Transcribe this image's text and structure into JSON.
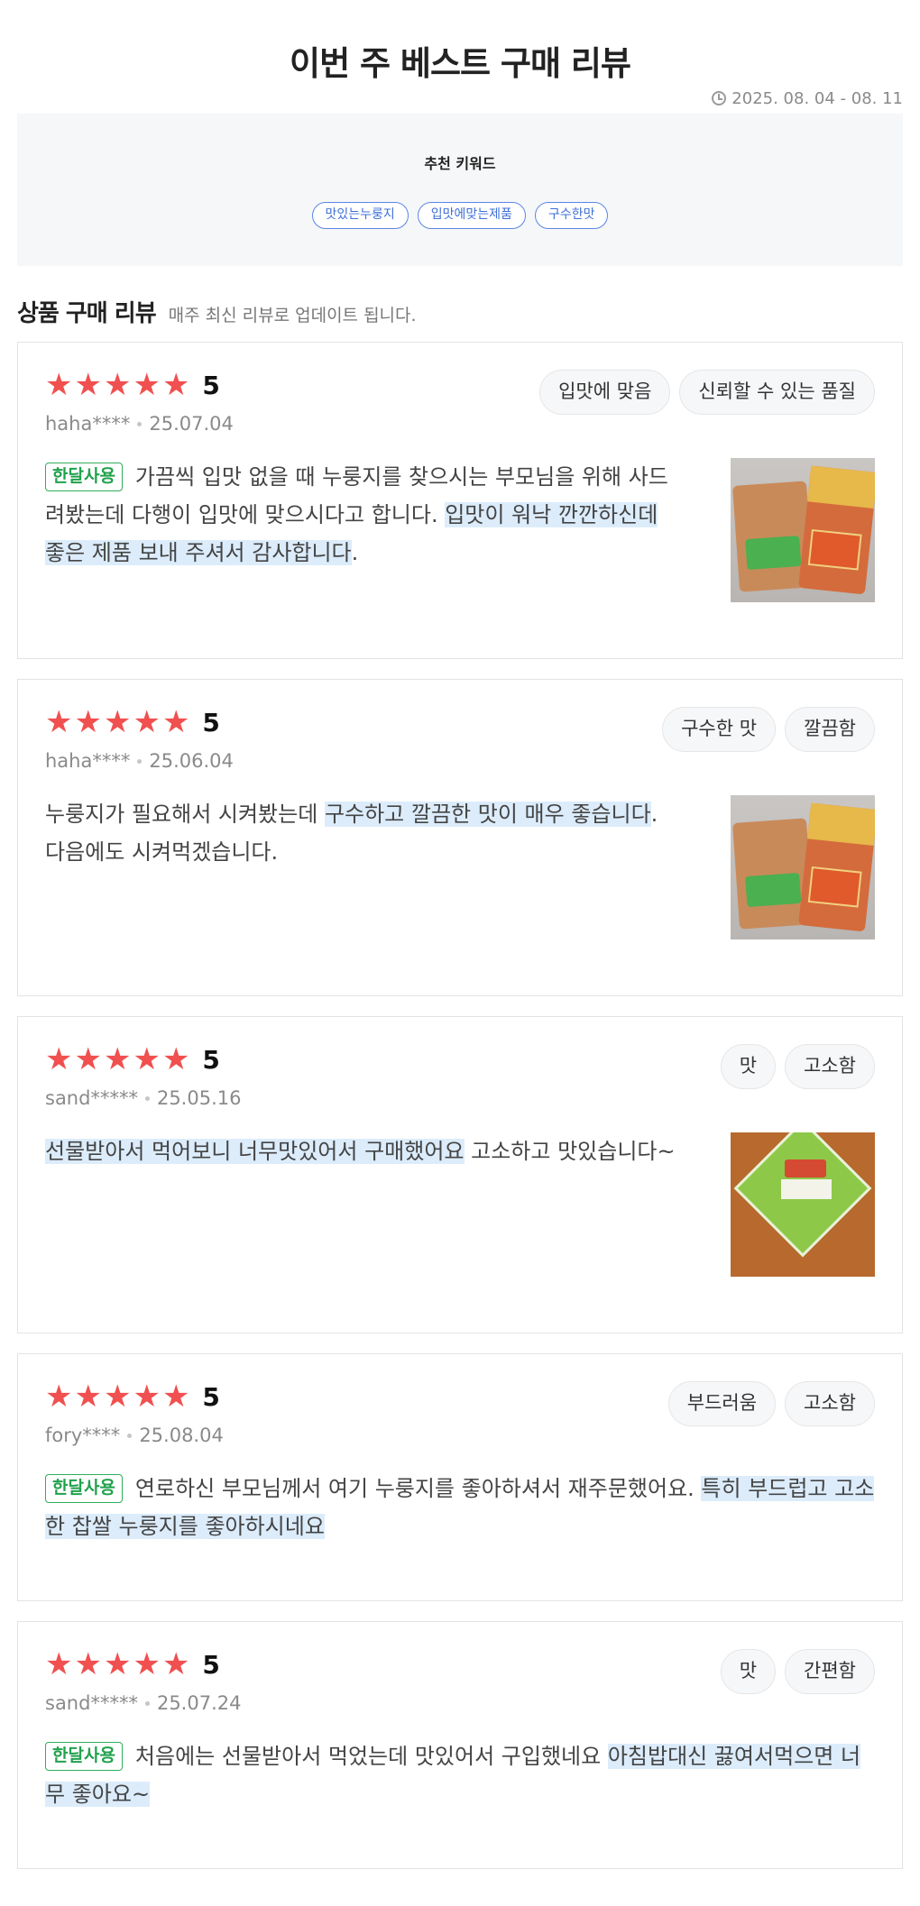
{
  "header": {
    "title": "이번 주 베스트 구매 리뷰",
    "period": "2025. 08. 04 - 08. 11"
  },
  "keywords": {
    "title": "추천 키워드",
    "chips": [
      "맛있는누룽지",
      "입맛에맞는제품",
      "구수한맛"
    ]
  },
  "section": {
    "title": "상품 구매 리뷰",
    "subtitle": "매주 최신 리뷰로 업데이트 됩니다."
  },
  "reviews": [
    {
      "rating": "5",
      "user": "haha****",
      "date": "25.07.04",
      "tags": [
        "입맛에 맞음",
        "신뢰할 수 있는 품질"
      ],
      "badge": "한달사용",
      "text_plain": "가끔씩 입맛 없을 때 누룽지를 찾으시는 부모님을 위해 사드려봤는데 다행이 입맛에 맞으시다고 합니다. ",
      "text_highlight": "입맛이 워낙 깐깐하신데 좋은 제품 보내 주셔서 감사합니다",
      "text_after": "."
    },
    {
      "rating": "5",
      "user": "haha****",
      "date": "25.06.04",
      "tags": [
        "구수한 맛",
        "깔끔함"
      ],
      "text_plain": "누룽지가 필요해서 시켜봤는데 ",
      "text_highlight": "구수하고 깔끔한 맛이 매우 좋습니다",
      "text_after": ". 다음에도 시켜먹겠습니다."
    },
    {
      "rating": "5",
      "user": "sand*****",
      "date": "25.05.16",
      "tags": [
        "맛",
        "고소함"
      ],
      "text_highlight": "선물받아서 먹어보니 너무맛있어서 구매했어요",
      "text_after": " 고소하고 맛있습니다~"
    },
    {
      "rating": "5",
      "user": "fory****",
      "date": "25.08.04",
      "tags": [
        "부드러움",
        "고소함"
      ],
      "badge": "한달사용",
      "text_plain": "연로하신 부모님께서 여기 누룽지를 좋아하셔서 재주문했어요. ",
      "text_highlight": "특히 부드럽고 고소한 찹쌀 누룽지를 좋아하시네요"
    },
    {
      "rating": "5",
      "user": "sand*****",
      "date": "25.07.24",
      "tags": [
        "맛",
        "간편함"
      ],
      "badge": "한달사용",
      "text_plain": "처음에는 선물받아서 먹었는데 맛있어서 구입했네요 ",
      "text_highlight": "아침밥대신 끓여서먹으면 너무 좋아요~"
    }
  ]
}
